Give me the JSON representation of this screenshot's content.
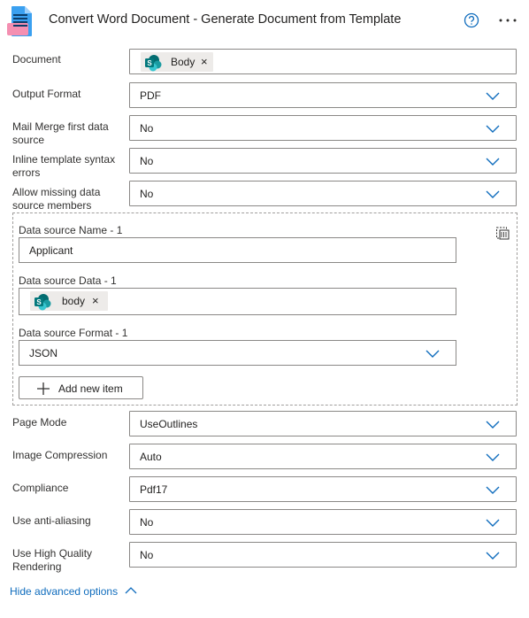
{
  "header": {
    "title": "Convert Word Document - Generate Document from Template",
    "icon": "word-document-icon",
    "help_icon": "help-circle-icon",
    "more_icon": "more-horizontal-icon"
  },
  "fields": {
    "document": {
      "label": "Document",
      "token": {
        "text": "Body",
        "icon": "sharepoint-icon"
      }
    },
    "output_format": {
      "label": "Output Format",
      "value": "PDF"
    },
    "mail_merge": {
      "label": "Mail Merge first data source",
      "value": "No"
    },
    "inline_template": {
      "label": "Inline template syntax errors",
      "value": "No"
    },
    "allow_missing": {
      "label": "Allow missing data source members",
      "value": "No"
    },
    "page_mode": {
      "label": "Page Mode",
      "value": "UseOutlines"
    },
    "image_compression": {
      "label": "Image Compression",
      "value": "Auto"
    },
    "compliance": {
      "label": "Compliance",
      "value": "Pdf17"
    },
    "anti_aliasing": {
      "label": "Use anti-aliasing",
      "value": "No"
    },
    "high_quality": {
      "label": "Use High Quality Rendering",
      "value": "No"
    }
  },
  "data_source": {
    "name_label": "Data source Name - 1",
    "name_value": "Applicant",
    "data_label": "Data source Data - 1",
    "data_token": {
      "text": "body",
      "icon": "sharepoint-icon"
    },
    "format_label": "Data source Format - 1",
    "format_value": "JSON",
    "add_button": "Add new item",
    "delete_icon": "delete-item-icon"
  },
  "footer": {
    "toggle_link": "Hide advanced options"
  },
  "colors": {
    "accent": "#0f6cbd",
    "border": "#8a8886",
    "token_bg": "#edebe9",
    "sharepoint": "#038387"
  }
}
